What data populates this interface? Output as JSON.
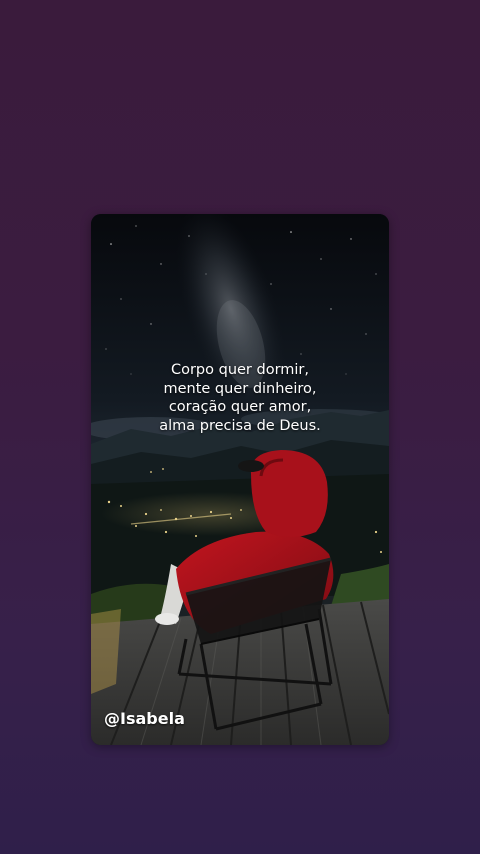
{
  "quote": {
    "lines": [
      "Corpo quer dormir,",
      "mente quer dinheiro,",
      "coração quer amor,",
      "alma precisa de Deus."
    ]
  },
  "handle": "@Isabela",
  "colors": {
    "background": "#3b1c40",
    "hoodie": "#b3141f",
    "text": "#ffffff"
  }
}
